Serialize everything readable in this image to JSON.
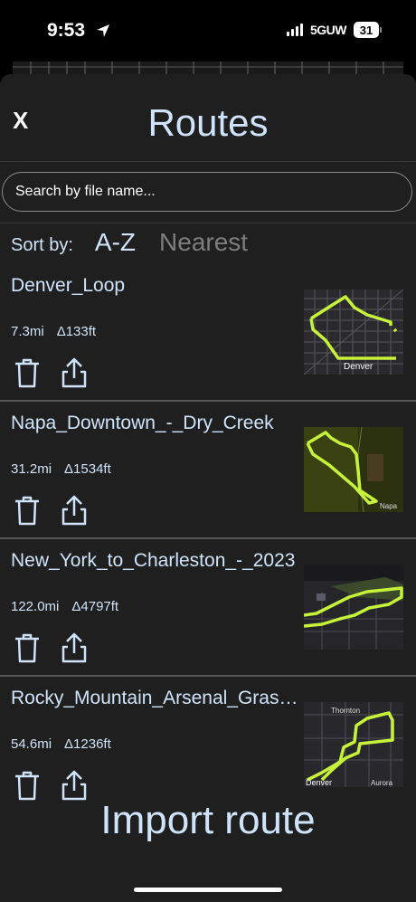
{
  "status": {
    "time": "9:53",
    "network": "5GUW",
    "battery": "31"
  },
  "sheet": {
    "close_label": "X",
    "title": "Routes",
    "search_placeholder": "Search by file name...",
    "sort_label": "Sort by:",
    "sort_options": [
      {
        "label": "A-Z",
        "active": true
      },
      {
        "label": "Nearest",
        "active": false
      }
    ],
    "routes": [
      {
        "name": "Denver_Loop",
        "distance": "7.3mi",
        "elevation": "Δ133ft",
        "map_label": "Denver",
        "map_theme": "dark"
      },
      {
        "name": "Napa_Downtown_-_Dry_Creek",
        "distance": "31.2mi",
        "elevation": "Δ1534ft",
        "map_label": "Napa",
        "map_theme": "satellite"
      },
      {
        "name": "New_York_to_Charleston_-_2023",
        "distance": "122.0mi",
        "elevation": "Δ4797ft",
        "map_label": "",
        "map_theme": "dark"
      },
      {
        "name": "Rocky_Mountain_Arsenal_Grasslands",
        "distance": "54.6mi",
        "elevation": "Δ1236ft",
        "map_label": "Denver",
        "map_label_2": "Aurora",
        "map_label_3": "Thornton",
        "map_theme": "dark"
      }
    ],
    "import_label": "Import route"
  },
  "colors": {
    "accent_text": "#cfe4fa",
    "route_line": "#c6f23a",
    "sheet_bg": "#1f1f1f",
    "inactive": "#7d7d7d"
  }
}
